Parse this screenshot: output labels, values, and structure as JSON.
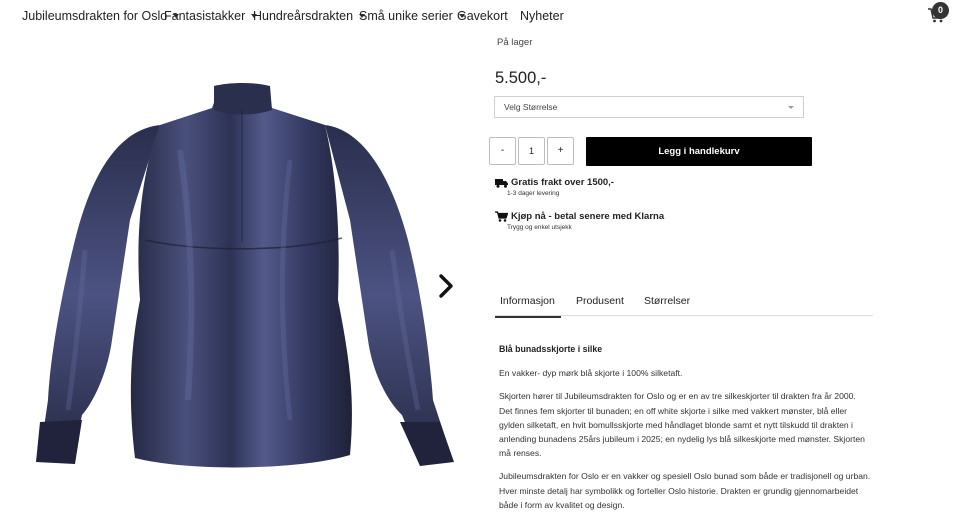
{
  "nav": {
    "items": [
      {
        "label": "Jubileumsdrakten for Oslo",
        "dropdown": true
      },
      {
        "label": "Fantasistakker",
        "dropdown": true
      },
      {
        "label": "Hundreårsdrakten",
        "dropdown": true
      },
      {
        "label": "Små unike serier",
        "dropdown": true
      },
      {
        "label": "Gavekort",
        "dropdown": false
      },
      {
        "label": "Nyheter",
        "dropdown": false
      }
    ],
    "cart_count": "0",
    "cart_icon": "cart-icon"
  },
  "product": {
    "image_alt_icon": "silk-shirt-image",
    "next_icon": "chevron-right-icon",
    "stock": "På lager",
    "price": "5.500,-",
    "size_select": {
      "selected": "Velg Størrelse"
    },
    "quantity": {
      "minus": "-",
      "value": "1",
      "plus": "+"
    },
    "add_to_cart": "Legg i handlekurv",
    "perks": [
      {
        "icon": "truck-icon",
        "title": "Gratis frakt over 1500,-",
        "sub": "1-3 dager levering"
      },
      {
        "icon": "cart-icon",
        "title": "Kjøp nå - betal senere med Klarna",
        "sub": "Trygg og enkel utsjekk"
      }
    ]
  },
  "tabs": [
    {
      "label": "Informasjon",
      "active": true
    },
    {
      "label": "Produsent",
      "active": false
    },
    {
      "label": "Størrelser",
      "active": false
    }
  ],
  "description": {
    "heading": "Blå bunadsskjorte i silke",
    "paragraphs": [
      "En vakker- dyp mørk blå skjorte i 100% silketaft.",
      "Skjorten hører til Jubileumsdrakten for Oslo og er en av tre silkeskjorter til drakten fra år 2000. Det finnes fem skjorter til bunaden; en off white skjorte i silke med vakkert mønster, blå eller gylden silketaft, en hvit bomullsskjorte med håndlaget blonde samt et nytt tilskudd til drakten i anlending bunadens 25års jubileum i 2025; en nydelig lys blå silkeskjorte med mønster. Skjorten må renses.",
      "Jubileumsdrakten for Oslo er en vakker og spesiell Oslo bunad som både er tradisjonell og urban. Hver minste detalj har symbolikk og forteller Oslo historie. Drakten er grundig gjennomarbeidet både i form av kvalitet og design."
    ]
  },
  "colors": {
    "button": "#000000",
    "shirt": "#3a3f66",
    "badge": "#333333"
  }
}
